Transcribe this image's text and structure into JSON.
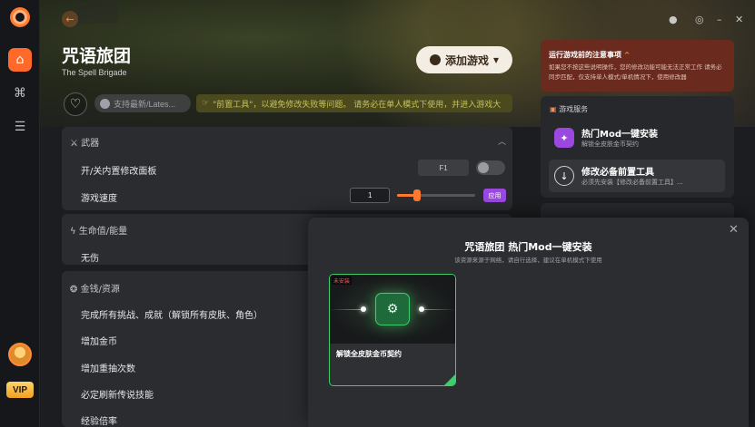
{
  "game": {
    "title": "咒语旅团",
    "subtitle": "The Spell Brigade",
    "add_game_label": "添加游戏",
    "version_label": "支持最新/Lates...",
    "notice": "\"前置工具\"，以避免修改失败等问题。 请务必在单人模式下使用，并进入游戏大"
  },
  "sections": {
    "weapons": "武器",
    "health": "生命值/能量",
    "money": "金钱/资源"
  },
  "rows": {
    "toggle_panel": "开/关内置修改面板",
    "hotkey": "F1",
    "game_speed": "游戏速度",
    "speed_value": "1",
    "apply": "应用",
    "invincible": "无伤",
    "unlock_all": "完成所有挑战、成就（解锁所有皮肤、角色）",
    "add_coins": "增加金币",
    "add_gacha": "增加重抽次数",
    "legend_refresh": "必定刷新传说技能",
    "partial": "经验倍率"
  },
  "slider": {
    "level": 0.22
  },
  "warning": {
    "title": "运行游戏前的注意事项",
    "body": "如果您不按这些说明操作，您的修改功能可能无法正常工作 请务必同步匹配，仅支持单人模式/单机情况下，使用修改器"
  },
  "services": {
    "title": "游戏服务",
    "items": [
      {
        "name": "热门Mod一键安装",
        "desc": "解锁全皮肤金币契约"
      },
      {
        "name": "修改必备前置工具",
        "desc": "必须先安装【修改必备前置工具】..."
      }
    ]
  },
  "modal": {
    "title": "咒语旅团 热门Mod一键安装",
    "subtitle": "该资源来源于网络，请自行选择，建议在单机模式下使用",
    "card_badge": "未安装",
    "card_name": "解锁全皮肤金币契约"
  },
  "vip": "VIP",
  "colors": {
    "accent": "#ff6a2a",
    "apply": "#9a48e0",
    "modal_border": "#3fcf6a"
  }
}
